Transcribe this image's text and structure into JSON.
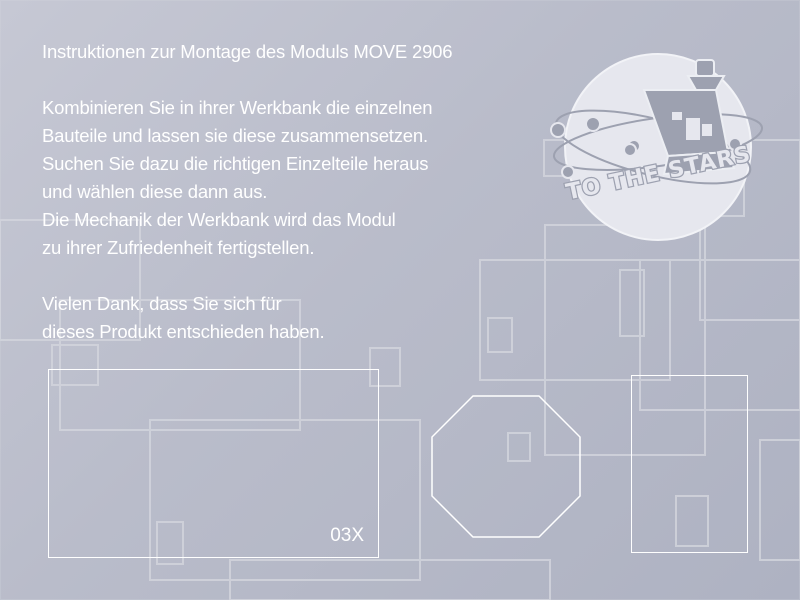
{
  "instructions": {
    "title": "Instruktionen zur Montage des Moduls MOVE 2906",
    "paragraph1": [
      "Kombinieren Sie in ihrer Werkbank die einzelnen",
      "Bauteile und lassen sie diese zusammensetzen.",
      "Suchen Sie dazu die richtigen Einzelteile heraus",
      "und wählen diese dann aus.",
      "Die Mechanik der Werkbank wird das Modul",
      "zu ihrer Zufriedenheit fertigstellen."
    ],
    "paragraph2": [
      "Vielen Dank, dass Sie sich für",
      "dieses Produkt entschieden haben."
    ]
  },
  "logo": {
    "text": "TO THE STARS",
    "icon": "rocket-badge-icon"
  },
  "slots": {
    "rect_label": "03X"
  },
  "colors": {
    "text": "#ffffff",
    "outline": "#ffffff",
    "background": "#bcbfcc"
  }
}
